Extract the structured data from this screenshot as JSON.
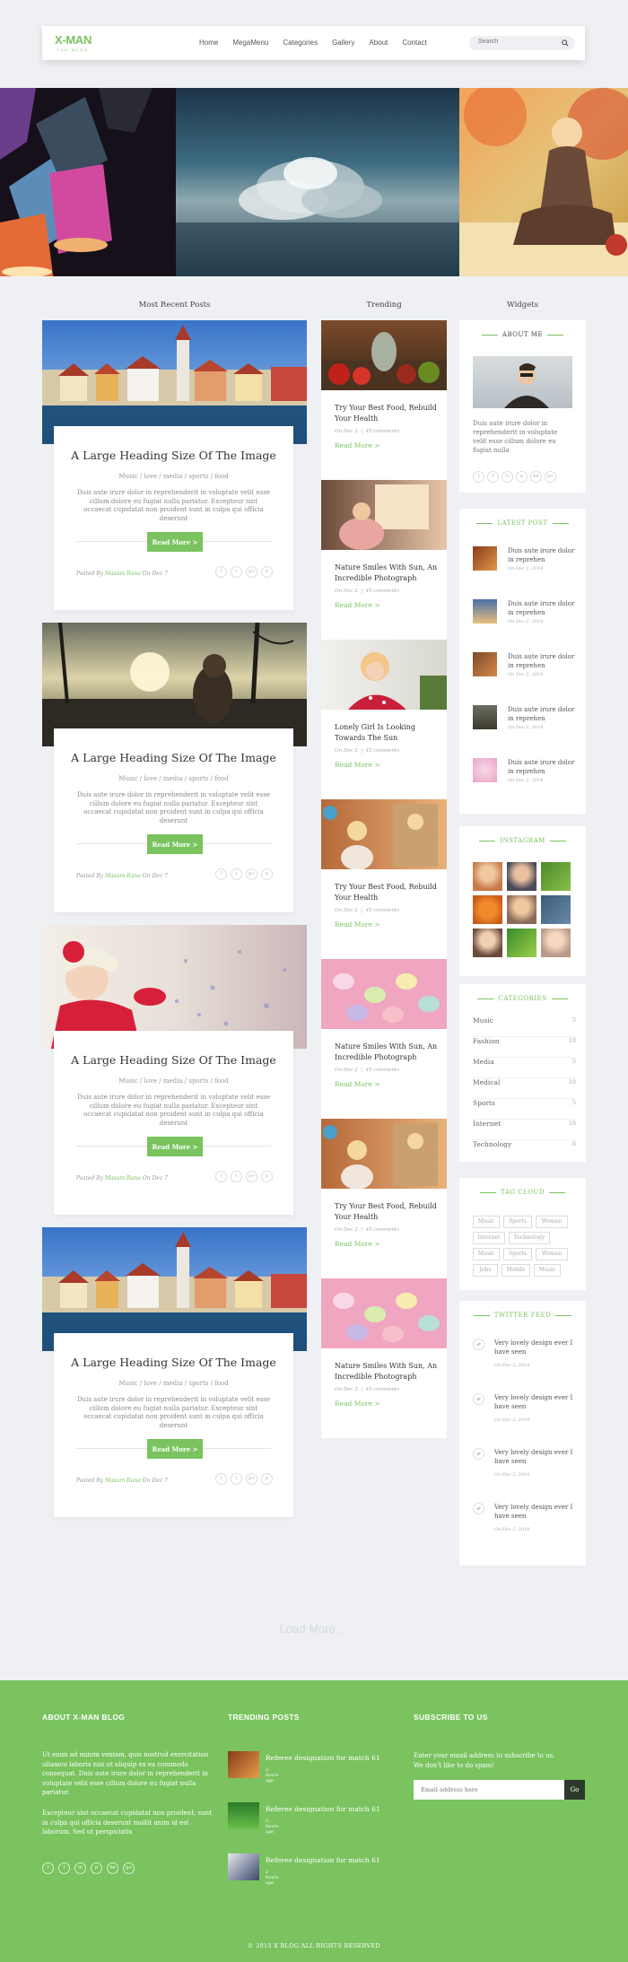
{
  "header": {
    "logo": "X-MAN",
    "logo_sub": "THE BLOG",
    "nav": [
      "Home",
      "MegaMenu",
      "Categories",
      "Gallery",
      "About",
      "Contact"
    ],
    "search_placeholder": "Search"
  },
  "columns": {
    "recent": "Most Recent Posts",
    "trending": "Trending",
    "widgets": "Widgets"
  },
  "posts": [
    {
      "title": "A Large Heading Size Of The Image",
      "tags": "Music / love / media / sports / food",
      "excerpt": "Duis aute irure dolor in reprehenderit in voluptate velit esse cillum dolore eu fugiat nulla pariatur. Excepteur sint occaecat cupidatat non proident sunt in culpa qui officia deserunt",
      "read_more": "Read More >",
      "meta_prefix": "Posted By",
      "author": "Masum Rana",
      "date": "On Dec 7"
    },
    {
      "title": "A Large Heading Size Of The Image",
      "tags": "Music / love / media / sports / food",
      "excerpt": "Duis aute irure dolor in reprehenderit in voluptate velit esse cillum dolore eu fugiat nulla pariatur. Excepteur sint occaecat cupidatat non proident sunt in culpa qui officia deserunt",
      "read_more": "Read More >",
      "meta_prefix": "Posted By",
      "author": "Masum Rana",
      "date": "On Dec 7"
    },
    {
      "title": "A Large Heading Size Of The Image",
      "tags": "Music / love / media / sports / food",
      "excerpt": "Duis aute irure dolor in reprehenderit in voluptate velit esse cillum dolore eu fugiat nulla pariatur. Excepteur sint occaecat cupidatat non proident sunt in culpa qui officia deserunt",
      "read_more": "Read More >",
      "meta_prefix": "Posted By",
      "author": "Masum Rana",
      "date": "On Dec 7"
    },
    {
      "title": "A Large Heading Size Of The Image",
      "tags": "Music / love / media / sports / food",
      "excerpt": "Duis aute irure dolor in reprehenderit in voluptate velit esse cillum dolore eu fugiat nulla pariatur. Excepteur sint occaecat cupidatat non proident sunt in culpa qui officia deserunt",
      "read_more": "Read More >",
      "meta_prefix": "Posted By",
      "author": "Masum Rana",
      "date": "On Dec 7"
    }
  ],
  "share_icons": [
    "f",
    "t",
    "g+",
    "p"
  ],
  "trending": [
    {
      "title": "Try Your Best Food, Rebuild Your Health",
      "date": "On Dec 2",
      "comments": "45 comments",
      "more": "Read More >"
    },
    {
      "title": "Nature Smiles With Sun, An Incredible Photograph",
      "date": "On Dec 2",
      "comments": "45 comments",
      "more": "Read More >"
    },
    {
      "title": "Lonely Girl Is Looking Towards The Sun",
      "date": "On Dec 2",
      "comments": "45 comments",
      "more": "Read More >"
    },
    {
      "title": "Try Your Best Food, Rebuild Your Health",
      "date": "On Dec 2",
      "comments": "45 comments",
      "more": "Read More >"
    },
    {
      "title": "Nature Smiles With Sun, An Incredible Photograph",
      "date": "On Dec 2",
      "comments": "45 comments",
      "more": "Read More >"
    },
    {
      "title": "Try Your Best Food, Rebuild Your Health",
      "date": "On Dec 2",
      "comments": "45 comments",
      "more": "Read More >"
    },
    {
      "title": "Nature Smiles With Sun, An Incredible Photograph",
      "date": "On Dec 2",
      "comments": "45 comments",
      "more": "Read More >"
    }
  ],
  "about": {
    "title": "ABOUT ME",
    "text": "Duis aute irure dolor in reprehenderit in voluptate velit esse cillum dolore eu fugiat nulla"
  },
  "latest": {
    "title": "LATEST POST",
    "items": [
      {
        "text": "Duis aute irure dolor in reprehen",
        "date": "On Dec 2, 2014"
      },
      {
        "text": "Duis aute irure dolor in reprehen",
        "date": "On Dec 2, 2014"
      },
      {
        "text": "Duis aute irure dolor in reprehen",
        "date": "On Dec 2, 2014"
      },
      {
        "text": "Duis aute irure dolor in reprehen",
        "date": "On Dec 2, 2014"
      },
      {
        "text": "Duis aute irure dolor in reprehen",
        "date": "On Dec 2, 2014"
      }
    ]
  },
  "instagram": {
    "title": "INSTAGRAM"
  },
  "categories": {
    "title": "CATEGORIES",
    "items": [
      {
        "name": "Music",
        "count": "5"
      },
      {
        "name": "Fashion",
        "count": "10"
      },
      {
        "name": "Media",
        "count": "5"
      },
      {
        "name": "Medical",
        "count": "10"
      },
      {
        "name": "Sports",
        "count": "5"
      },
      {
        "name": "Internet",
        "count": "10"
      },
      {
        "name": "Technology",
        "count": "6"
      }
    ]
  },
  "tag_cloud": {
    "title": "TAG CLOUD",
    "tags": [
      "Music",
      "Sports",
      "Women",
      "Internet",
      "Technology",
      "Music",
      "Sports",
      "Women",
      "Jobs",
      "Mobile",
      "Music"
    ]
  },
  "twitter": {
    "title": "TWITTER FEED",
    "items": [
      {
        "text": "Very lovely design ever I have seen",
        "date": "On Dec 2, 2014"
      },
      {
        "text": "Very lovely design ever I have seen",
        "date": "On Dec 2, 2014"
      },
      {
        "text": "Very lovely design ever I have seen",
        "date": "On Dec 2, 2014"
      },
      {
        "text": "Very lovely design ever I have seen",
        "date": "On Dec 2, 2014"
      }
    ]
  },
  "load_more": "Load More ...",
  "footer": {
    "about_title": "ABOUT X-MAN BLOG",
    "about_p1": "Ut enim ad minim veniam, quis nostrud exercitation ullamco laboris nisi ut aliquip ex ea commodo consequat. Duis aute irure dolor in reprehenderit in voluptate velit esse cillum dolore eu fugiat nulla pariatur.",
    "about_p2": "Excepteur sint occaecat cupidatat non proident, sunt in culpa qui officia deserunt mollit anim id est laborum. Sed ut perspiciatis",
    "social_icons": [
      "f",
      "t",
      "in",
      "p",
      "be",
      "g+"
    ],
    "trending_title": "TRENDING POSTS",
    "trending": [
      {
        "text": "Referee designation for match 61",
        "time": "2 hours ago"
      },
      {
        "text": "Referee designation for match 61",
        "time": "2 hours ago"
      },
      {
        "text": "Referee designation for match 61",
        "time": "2 hours ago"
      }
    ],
    "subscribe_title": "SUBSCRIBE TO US",
    "subscribe_text": "Enter your email address to subscribe to us. We don't like to do spam!",
    "email_placeholder": "Email address here",
    "go": "Go",
    "copyright": "© 2015 X BLOG ALL RIGHTS RESERVED"
  }
}
